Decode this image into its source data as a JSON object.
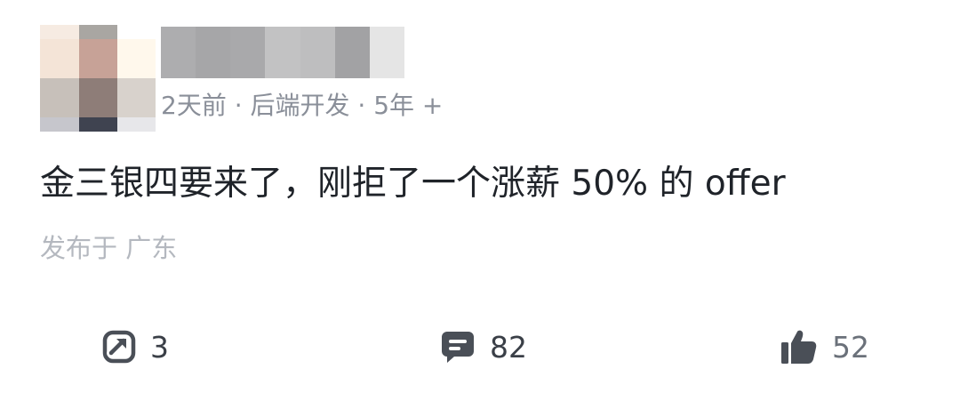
{
  "post": {
    "meta": "2天前 · 后端开发 · 5年 +",
    "text": "金三银四要来了，刚拒了一个涨薪 50% 的 offer",
    "location": "发布于 广东"
  },
  "actions": {
    "share": {
      "icon": "share-icon",
      "count": "3"
    },
    "comment": {
      "icon": "comment-icon",
      "count": "82"
    },
    "like": {
      "icon": "thumbs-up-icon",
      "count": "52"
    }
  },
  "colors": {
    "text": "#1f2329",
    "meta": "#8a8f99",
    "location": "#b4b8bf",
    "icon": "#3a3f47"
  }
}
